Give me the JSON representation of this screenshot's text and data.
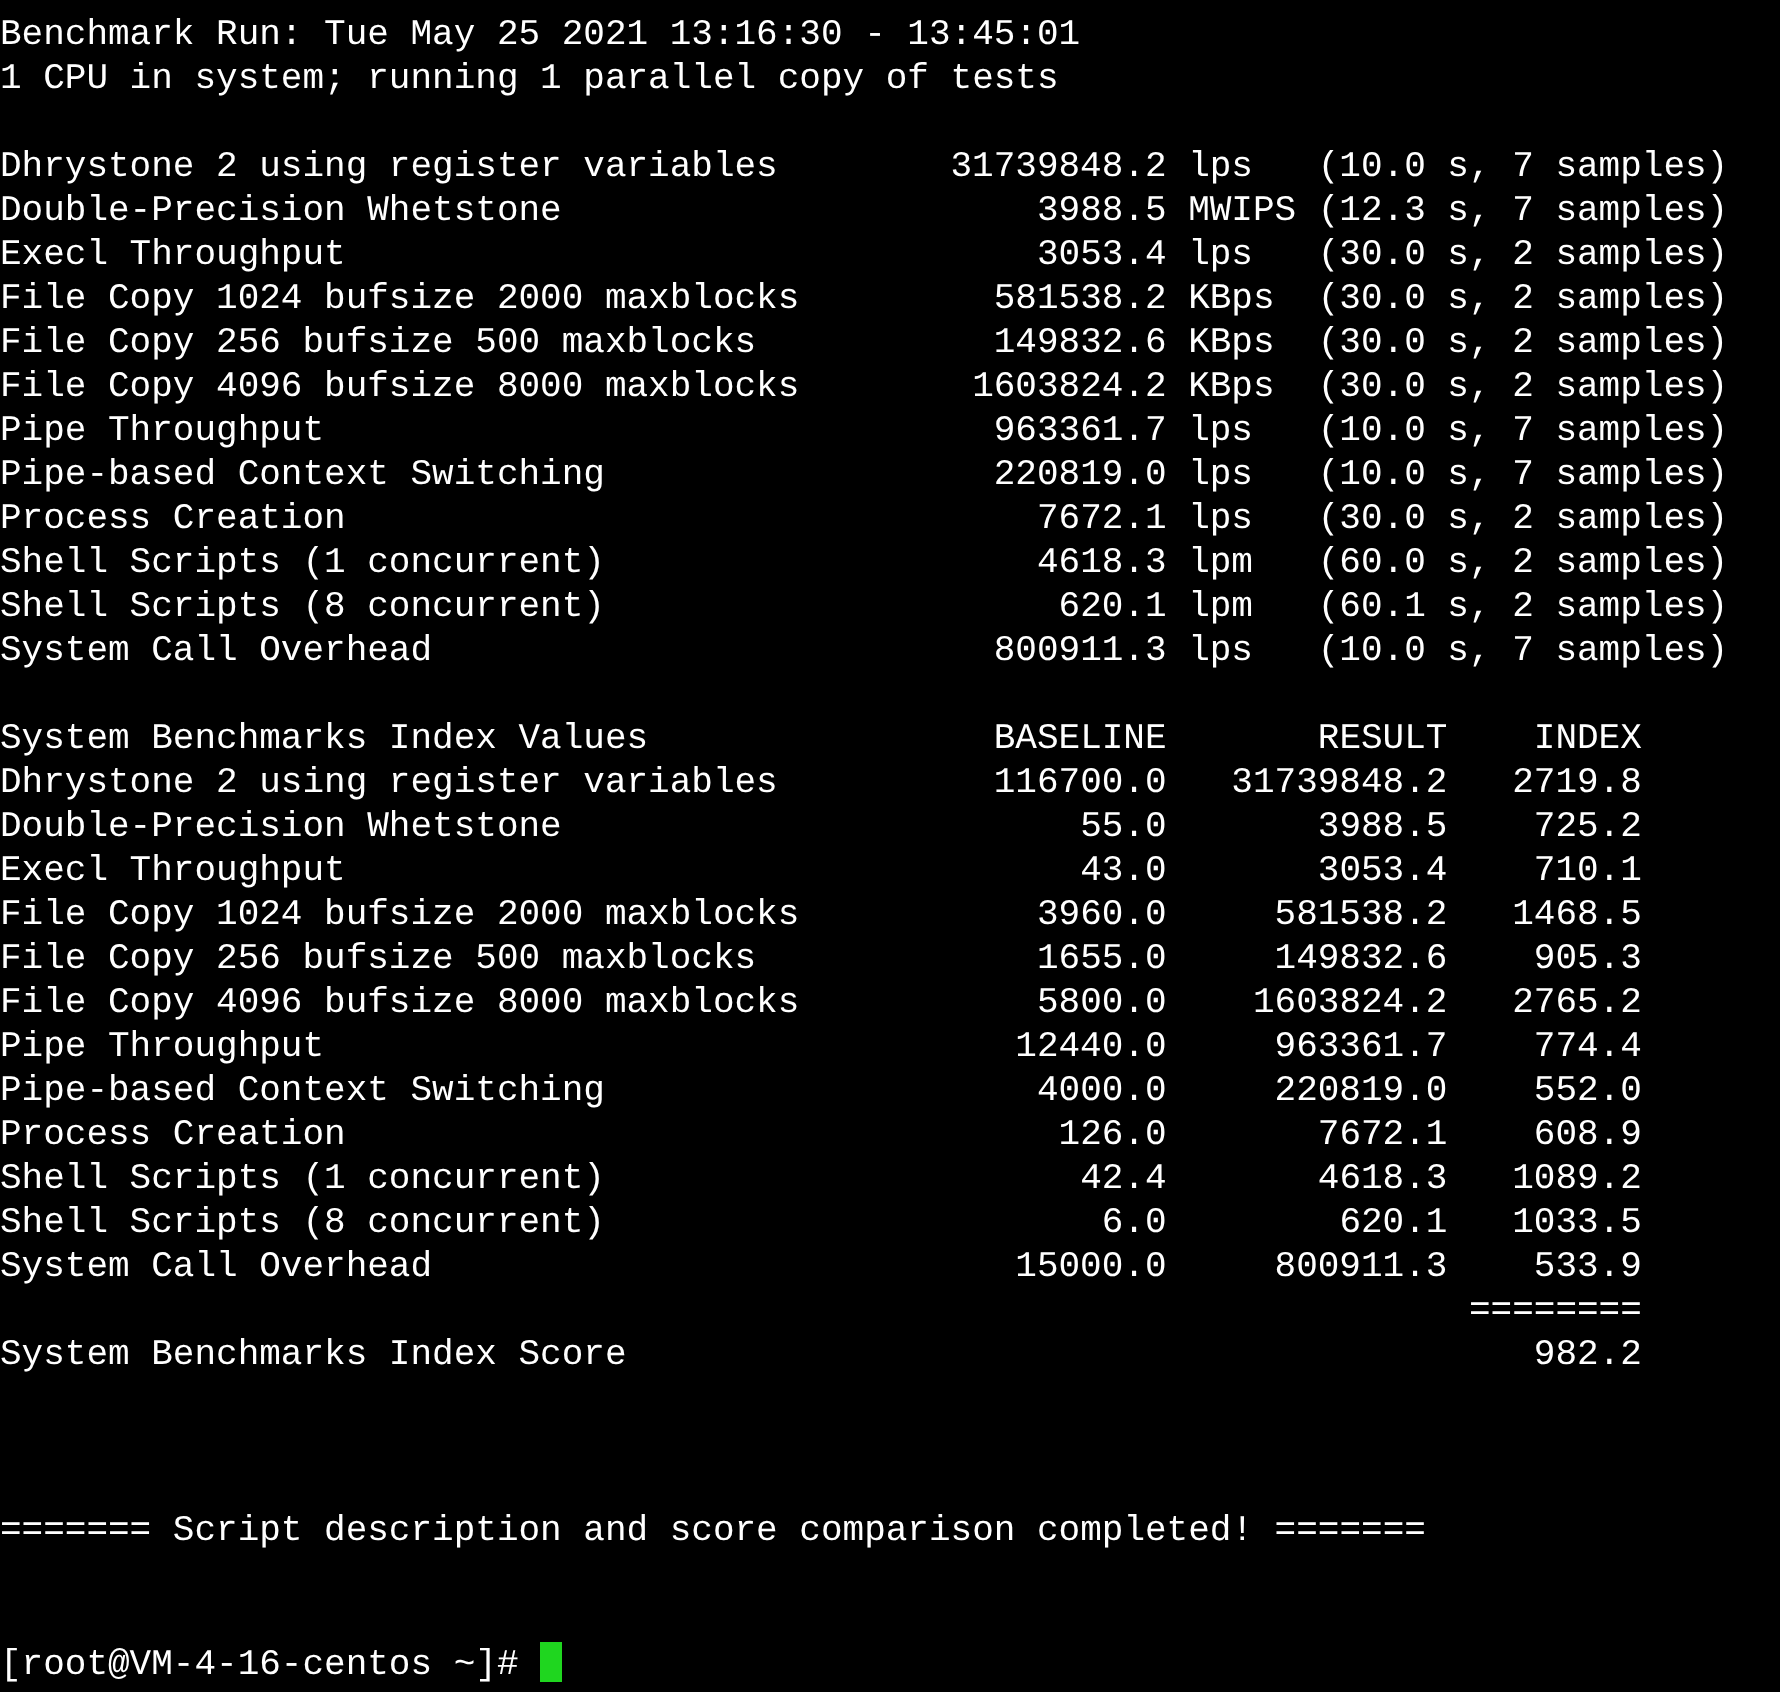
{
  "header": [
    "Benchmark Run: Tue May 25 2021 13:16:30 - 13:45:01",
    "1 CPU in system; running 1 parallel copy of tests"
  ],
  "results": [
    {
      "name": "Dhrystone 2 using register variables",
      "value": "31739848.2",
      "unit": "lps",
      "timing": "(10.0 s, 7 samples)"
    },
    {
      "name": "Double-Precision Whetstone",
      "value": "3988.5",
      "unit": "MWIPS",
      "timing": "(12.3 s, 7 samples)"
    },
    {
      "name": "Execl Throughput",
      "value": "3053.4",
      "unit": "lps",
      "timing": "(30.0 s, 2 samples)"
    },
    {
      "name": "File Copy 1024 bufsize 2000 maxblocks",
      "value": "581538.2",
      "unit": "KBps",
      "timing": "(30.0 s, 2 samples)"
    },
    {
      "name": "File Copy 256 bufsize 500 maxblocks",
      "value": "149832.6",
      "unit": "KBps",
      "timing": "(30.0 s, 2 samples)"
    },
    {
      "name": "File Copy 4096 bufsize 8000 maxblocks",
      "value": "1603824.2",
      "unit": "KBps",
      "timing": "(30.0 s, 2 samples)"
    },
    {
      "name": "Pipe Throughput",
      "value": "963361.7",
      "unit": "lps",
      "timing": "(10.0 s, 7 samples)"
    },
    {
      "name": "Pipe-based Context Switching",
      "value": "220819.0",
      "unit": "lps",
      "timing": "(10.0 s, 7 samples)"
    },
    {
      "name": "Process Creation",
      "value": "7672.1",
      "unit": "lps",
      "timing": "(30.0 s, 2 samples)"
    },
    {
      "name": "Shell Scripts (1 concurrent)",
      "value": "4618.3",
      "unit": "lpm",
      "timing": "(60.0 s, 2 samples)"
    },
    {
      "name": "Shell Scripts (8 concurrent)",
      "value": "620.1",
      "unit": "lpm",
      "timing": "(60.1 s, 2 samples)"
    },
    {
      "name": "System Call Overhead",
      "value": "800911.3",
      "unit": "lps",
      "timing": "(10.0 s, 7 samples)"
    }
  ],
  "index_table": {
    "columns": [
      "System Benchmarks Index Values",
      "BASELINE",
      "RESULT",
      "INDEX"
    ],
    "rows": [
      [
        "Dhrystone 2 using register variables",
        "116700.0",
        "31739848.2",
        "2719.8"
      ],
      [
        "Double-Precision Whetstone",
        "55.0",
        "3988.5",
        "725.2"
      ],
      [
        "Execl Throughput",
        "43.0",
        "3053.4",
        "710.1"
      ],
      [
        "File Copy 1024 bufsize 2000 maxblocks",
        "3960.0",
        "581538.2",
        "1468.5"
      ],
      [
        "File Copy 256 bufsize 500 maxblocks",
        "1655.0",
        "149832.6",
        "905.3"
      ],
      [
        "File Copy 4096 bufsize 8000 maxblocks",
        "5800.0",
        "1603824.2",
        "2765.2"
      ],
      [
        "Pipe Throughput",
        "12440.0",
        "963361.7",
        "774.4"
      ],
      [
        "Pipe-based Context Switching",
        "4000.0",
        "220819.0",
        "552.0"
      ],
      [
        "Process Creation",
        "126.0",
        "7672.1",
        "608.9"
      ],
      [
        "Shell Scripts (1 concurrent)",
        "42.4",
        "4618.3",
        "1089.2"
      ],
      [
        "Shell Scripts (8 concurrent)",
        "6.0",
        "620.1",
        "1033.5"
      ],
      [
        "System Call Overhead",
        "15000.0",
        "800911.3",
        "533.9"
      ]
    ],
    "separator": "========",
    "score_label": "System Benchmarks Index Score",
    "score": "982.2"
  },
  "completion_message": "======= Script description and score comparison completed! =======",
  "prompt": "[root@VM-4-16-centos ~]#"
}
